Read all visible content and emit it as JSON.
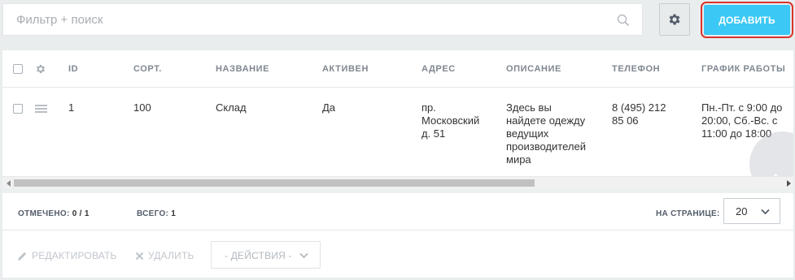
{
  "filter": {
    "placeholder": "Фильтр + поиск",
    "value": ""
  },
  "toolbar": {
    "add_label": "ДОБАВИТЬ"
  },
  "grid": {
    "columns": [
      "ID",
      "СОРТ.",
      "НАЗВАНИЕ",
      "АКТИВЕН",
      "АДРЕС",
      "ОПИСАНИЕ",
      "ТЕЛЕФОН",
      "ГРАФИК РАБОТЫ"
    ],
    "rows": [
      {
        "id": "1",
        "sort": "100",
        "name": "Склад",
        "active": "Да",
        "address": [
          "пр.",
          "Московский",
          "д. 51"
        ],
        "description": [
          "Здесь вы",
          "найдете одежду",
          "ведущих",
          "производителей",
          "мира"
        ],
        "phone": [
          "8 (495) 212",
          "85 06"
        ],
        "schedule": [
          "Пн.-Пт. с 9:00 до",
          "20:00, Сб.-Вс. с",
          "11:00 до 18:00"
        ]
      }
    ]
  },
  "footer": {
    "checked_label": "ОТМЕЧЕНО:",
    "checked_value": "0 / 1",
    "total_label": "ВСЕГО:",
    "total_value": "1",
    "per_page_label": "НА СТРАНИЦЕ:",
    "per_page_value": "20"
  },
  "actions": {
    "edit_label": "РЕДАКТИРОВАТЬ",
    "delete_label": "УДАЛИТЬ",
    "actions_select_label": "- ДЕЙСТВИЯ -"
  },
  "colors": {
    "accent": "#3bc8f5",
    "highlight_border": "#d9342b"
  }
}
